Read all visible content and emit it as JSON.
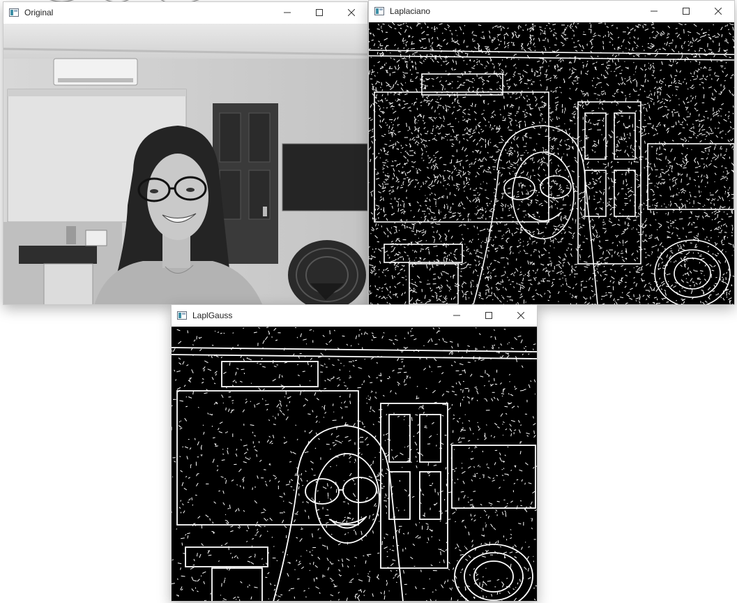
{
  "windows": {
    "original": {
      "title": "Original",
      "icon": "opencv-window-icon"
    },
    "laplaciano": {
      "title": "Laplaciano",
      "icon": "opencv-window-icon"
    },
    "laplgauss": {
      "title": "LaplGauss",
      "icon": "opencv-window-icon"
    }
  },
  "controls": {
    "minimize": "minimize-icon",
    "maximize": "maximize-icon",
    "close": "close-icon"
  },
  "colors": {
    "titlebar": "#ffffff",
    "edge_background": "#000000",
    "edge_foreground": "#ffffff",
    "photo_wall": "#cfcfcf"
  }
}
